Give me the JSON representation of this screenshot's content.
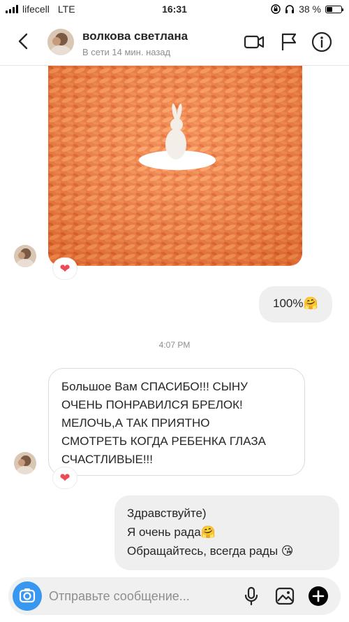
{
  "status_bar": {
    "carrier": "lifecell",
    "network": "LTE",
    "time": "16:31",
    "battery": "38 %",
    "battery_level": 0.38
  },
  "header": {
    "name": "волкова светлана",
    "status": "В сети 14 мин. назад",
    "icons": [
      "back-chevron-icon",
      "video-call-icon",
      "flag-icon",
      "info-icon"
    ]
  },
  "messages": {
    "photo_reaction": "❤",
    "out_1": "100%🤗",
    "timestamp": "4:07 PM",
    "in_1_lines": [
      "Большое Вам СПАСИБО!!! СЫНУ",
      "ОЧЕНЬ ПОНРАВИЛСЯ БРЕЛОК!",
      "МЕЛОЧЬ,А ТАК ПРИЯТНО",
      "СМОТРЕТЬ КОГДА РЕБЕНКА ГЛАЗА",
      "СЧАСТЛИВЫЕ!!!"
    ],
    "in_1_reaction": "❤",
    "out_2_lines": [
      "Здравствуйте)",
      "Я очень рада🤗",
      "Обращайтесь, всегда рады 😘"
    ]
  },
  "composer": {
    "placeholder": "Отправьте сообщение...",
    "icons": [
      "camera-icon",
      "microphone-icon",
      "gallery-icon",
      "plus-icon"
    ]
  },
  "colors": {
    "accent": "#3897f0",
    "heart": "#ed4956",
    "bubble_out": "#efefef",
    "carrot": "#f07a3a"
  }
}
